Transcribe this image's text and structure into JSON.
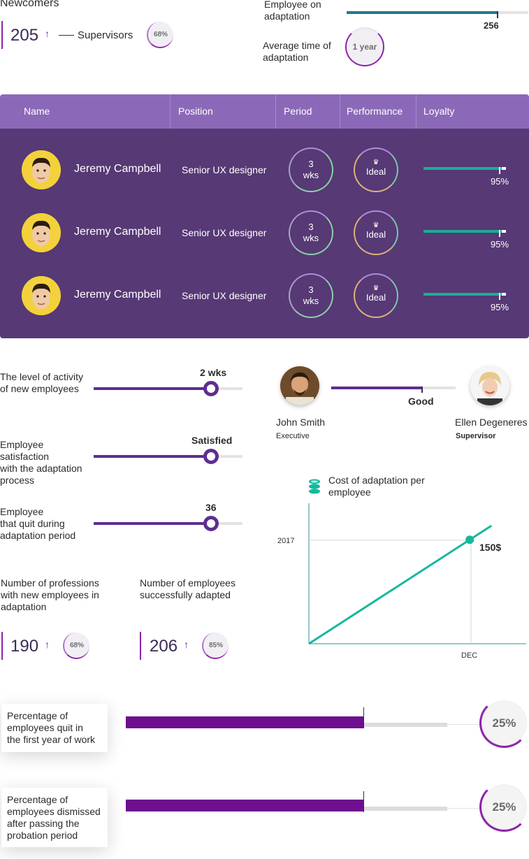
{
  "top": {
    "newcomers_title": "Newcomers",
    "newcomers_count": "205",
    "supervisors_label": "Supervisors",
    "supervisors_pct": "68%",
    "employee_on_adaptation_label": "Employee on\nadaptation",
    "employee_on_adaptation_value": "256",
    "employee_on_adaptation_fraction": 0.83,
    "avg_time_label": "Average time of\nadaptation",
    "avg_time_value": "1 year"
  },
  "table": {
    "headers": [
      "Name",
      "Position",
      "Period",
      "Performance",
      "Loyalty"
    ],
    "rows": [
      {
        "name": "Jeremy Campbell",
        "position": "Senior UX designer",
        "period_line1": "3",
        "period_line2": "wks",
        "performance": "Ideal",
        "loyalty": "95%",
        "loyalty_fraction": 0.95
      },
      {
        "name": "Jeremy Campbell",
        "position": "Senior UX designer",
        "period_line1": "3",
        "period_line2": "wks",
        "performance": "Ideal",
        "loyalty": "95%",
        "loyalty_fraction": 0.95
      },
      {
        "name": "Jeremy Campbell",
        "position": "Senior UX designer",
        "period_line1": "3",
        "period_line2": "wks",
        "performance": "Ideal",
        "loyalty": "95%",
        "loyalty_fraction": 0.95
      }
    ]
  },
  "metrics": {
    "activity_label": "The level of activity\nof new employees",
    "activity_value": "2 wks",
    "activity_fraction": 0.79,
    "satisfaction_label": "Employee\nsatisfaction\nwith the adaptation\nprocess",
    "satisfaction_value": "Satisfied",
    "satisfaction_fraction": 0.79,
    "quit_label": "Employee\nthat quit during\nadaptation period",
    "quit_value": "36",
    "quit_fraction": 0.79
  },
  "supervision": {
    "left_name": "John Smith",
    "left_role": "Executive",
    "right_name": "Ellen Degeneres",
    "right_role": "Supervisor",
    "relation_label": "Good",
    "relation_fraction": 0.73
  },
  "counters": {
    "professions_label": "Number of professions\nwith new employees in\nadaptation",
    "professions_value": "190",
    "professions_pct": "68%",
    "adapted_label": "Number of employees\nsuccessfully adapted",
    "adapted_value": "206",
    "adapted_pct": "85%"
  },
  "chart_data": {
    "type": "line",
    "title": "Cost of adaptation per\nemployee",
    "y_tick": "2017",
    "x_tick": "DEC",
    "highlight_value": "150$",
    "points": [
      {
        "x": 0,
        "y": 0
      },
      {
        "x": 0.74,
        "y": 0.74
      },
      {
        "x": 0.84,
        "y": 0.84
      }
    ],
    "icon": "coins-icon",
    "line_color": "#16b89e"
  },
  "bottom": [
    {
      "label": "Percentage of\nemployees quit in\nthe first year of work",
      "value": "25%",
      "fraction": 0.74
    },
    {
      "label": "Percentage of\nemployees dismissed\nafter passing the\nprobation period",
      "value": "25%",
      "fraction": 0.74
    }
  ],
  "colors": {
    "accent": "#8e24aa",
    "header": "#8c69b8",
    "body": "#563975",
    "teal": "#16b89e"
  }
}
